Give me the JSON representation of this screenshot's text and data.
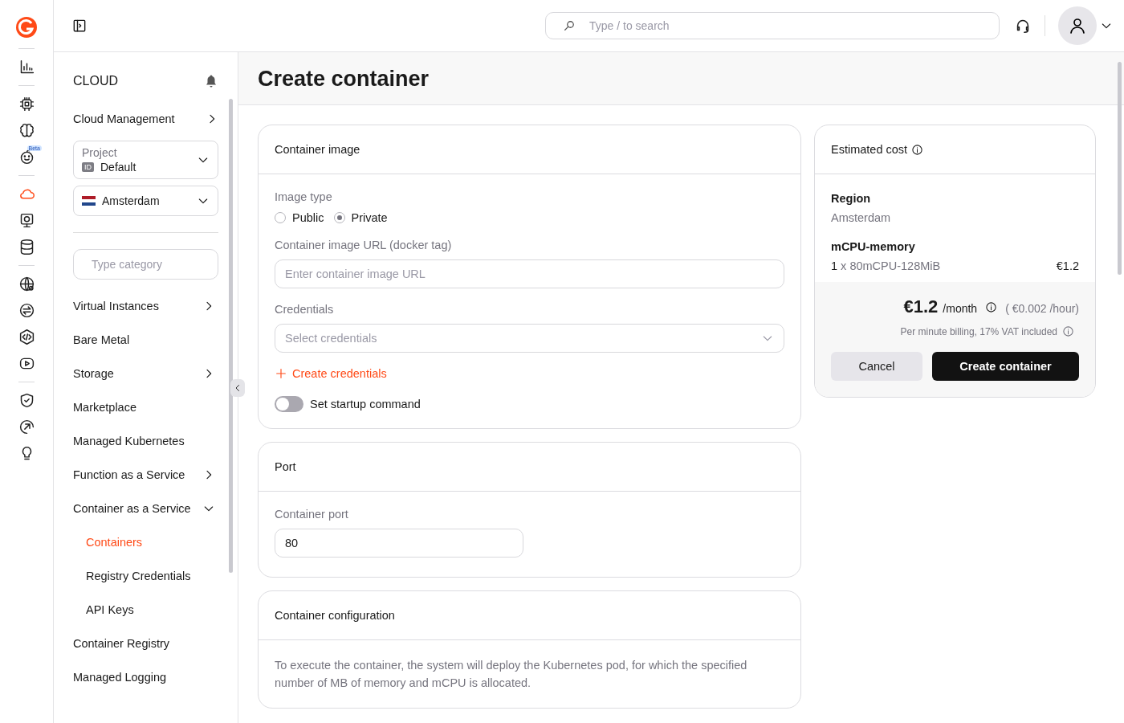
{
  "rail": {
    "groups": [
      [
        {
          "kind": "chart",
          "selected": false
        }
      ],
      [
        {
          "kind": "chip",
          "selected": false
        },
        {
          "kind": "brain",
          "selected": false
        },
        {
          "kind": "robot",
          "selected": false,
          "badge": "Beta"
        }
      ],
      [
        {
          "kind": "cloud",
          "selected": true
        },
        {
          "kind": "monitor",
          "selected": false
        },
        {
          "kind": "database",
          "selected": false
        }
      ],
      [
        {
          "kind": "globe",
          "selected": false
        },
        {
          "kind": "swap",
          "selected": false
        },
        {
          "kind": "code",
          "selected": false
        },
        {
          "kind": "play",
          "selected": false
        }
      ],
      [
        {
          "kind": "shield",
          "selected": false
        },
        {
          "kind": "arrow",
          "selected": false
        },
        {
          "kind": "bulb",
          "selected": false
        }
      ]
    ]
  },
  "topbar": {
    "search": {
      "placeholder": "Type / to search"
    }
  },
  "sidebar": {
    "title": "CLOUD",
    "management": {
      "label": "Cloud Management",
      "expanded": false
    },
    "project": {
      "label": "Project",
      "badge": "ID",
      "value": "Default"
    },
    "region": {
      "value": "Amsterdam"
    },
    "search": {
      "placeholder": "Type category"
    },
    "items": [
      {
        "label": "Virtual Instances",
        "selected": false,
        "expanded": false
      },
      {
        "label": "Bare Metal",
        "selected": false
      },
      {
        "label": "Storage",
        "selected": false,
        "expanded": false
      },
      {
        "label": "Marketplace",
        "selected": false
      },
      {
        "label": "Managed Kubernetes",
        "selected": false
      },
      {
        "label": "Function as a Service",
        "selected": false,
        "expanded": false
      },
      {
        "label": "Container as a Service",
        "selected": false,
        "expanded": true,
        "children": [
          {
            "label": "Containers",
            "selected": true
          },
          {
            "label": "Registry Credentials",
            "selected": false
          },
          {
            "label": "API Keys",
            "selected": false
          }
        ]
      },
      {
        "label": "Container Registry",
        "selected": false
      },
      {
        "label": "Managed Logging",
        "selected": false
      }
    ]
  },
  "page": {
    "title": "Create container"
  },
  "image_card": {
    "title": "Container image",
    "image_type_label": "Image type",
    "image_types": [
      {
        "label": "Public",
        "selected": false
      },
      {
        "label": "Private",
        "selected": true
      }
    ],
    "url": {
      "label": "Container image URL (docker tag)",
      "placeholder": "Enter container image URL"
    },
    "credentials": {
      "label": "Credentials",
      "placeholder": "Select credentials"
    },
    "create_link": "Create credentials",
    "startup": {
      "label": "Set startup command",
      "on": false
    }
  },
  "port_card": {
    "title": "Port",
    "label": "Container port",
    "value": "80"
  },
  "config_card": {
    "title": "Container configuration",
    "description": "To execute the container, the system will deploy the Kubernetes pod, for which the specified number of MB of memory and mCPU is allocated."
  },
  "cost": {
    "title": "Estimated cost",
    "region_label": "Region",
    "region_value": "Amsterdam",
    "resource_label": "mCPU-memory",
    "line": {
      "qty": "1",
      "item": "x 80mCPU-128MiB",
      "price": "€1.2"
    },
    "total": "€1.2",
    "period": "/month",
    "hourly": "( €0.002 /hour)",
    "note": "Per minute billing, 17% VAT included",
    "buttons": [
      {
        "label": "Cancel",
        "kind": "secondary"
      },
      {
        "label": "Create container",
        "kind": "primary"
      }
    ]
  }
}
